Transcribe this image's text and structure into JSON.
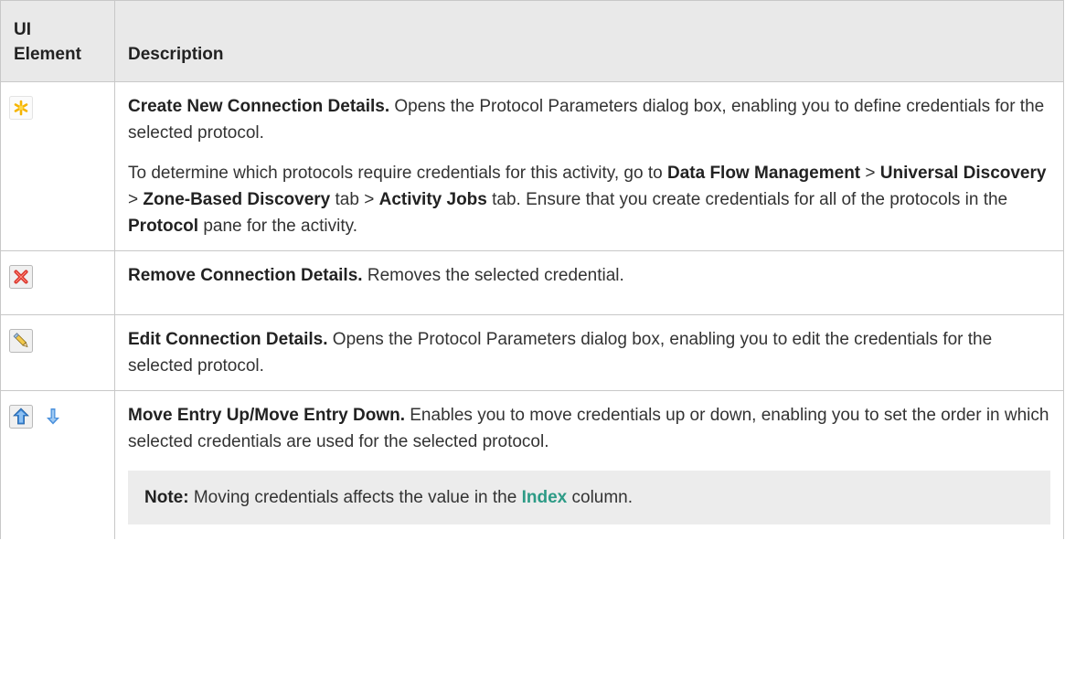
{
  "header": {
    "col1": "UI Element",
    "col2": "Description"
  },
  "rows": [
    {
      "icon": "asterisk-icon",
      "title": "Create New Connection Details.",
      "text": " Opens the Protocol Parameters dialog box, enabling you to define credentials for the selected protocol.",
      "para2": {
        "t1": "To determine which protocols require credentials for this activity, go to ",
        "b1": "Data Flow Management",
        "s1": " > ",
        "b2": "Universal Discovery",
        "s2": " > ",
        "b3": "Zone-Based Discovery",
        "t2": " tab > ",
        "b4": "Activity Jobs",
        "t3": " tab. Ensure that you create credentials for all of the protocols in the ",
        "b5": "Protocol",
        "t4": " pane for the activity."
      }
    },
    {
      "icon": "red-x-icon",
      "title": "Remove Connection Details.",
      "text": " Removes the selected credential."
    },
    {
      "icon": "pencil-icon",
      "title": "Edit Connection Details.",
      "text": " Opens the Protocol Parameters dialog box, enabling you to edit the credentials for the selected protocol."
    },
    {
      "icons": [
        "arrow-up-icon",
        "arrow-down-icon"
      ],
      "title": "Move Entry Up/Move Entry Down.",
      "text": " Enables you to move credentials up or down, enabling you to set the order in which selected credentials are used for the selected protocol.",
      "note": {
        "label": "Note:",
        "t1": " Moving credentials affects the value in the ",
        "link": "Index",
        "t2": " column."
      }
    }
  ],
  "colors": {
    "link": "#2d9b86",
    "header_bg": "#e9e9e9",
    "note_bg": "#ececec"
  }
}
